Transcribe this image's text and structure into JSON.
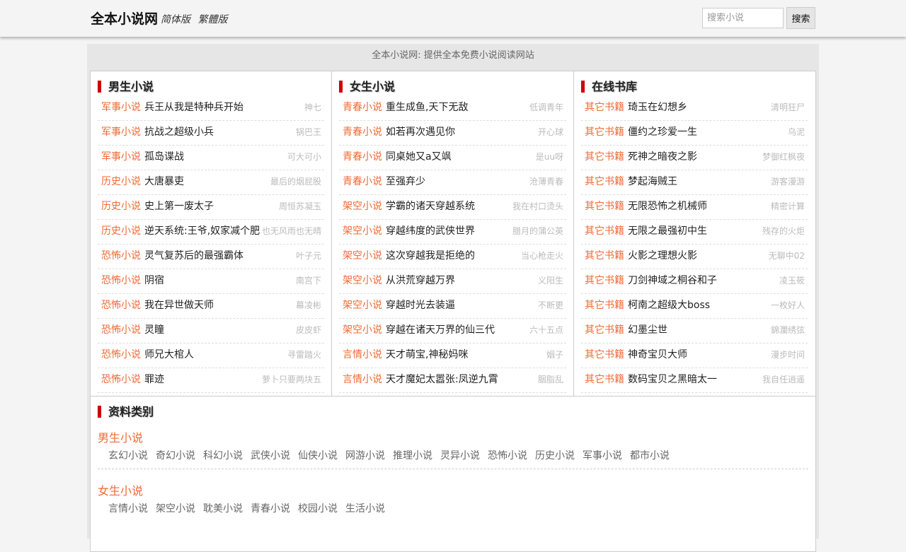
{
  "header": {
    "site_name": "全本小说网",
    "version_links": [
      "简体版",
      "繁體版"
    ],
    "search": {
      "placeholder": "搜索小说",
      "value": "",
      "button_label": "搜索"
    }
  },
  "slogan": "全本小说网: 提供全本免费小说阅读网站",
  "panels": [
    {
      "title": "男生小说",
      "books": [
        {
          "category": "军事小说",
          "title": "兵王从我是特种兵开始",
          "author": "神七"
        },
        {
          "category": "军事小说",
          "title": "抗战之超级小兵",
          "author": "锅巴王"
        },
        {
          "category": "军事小说",
          "title": "孤岛谍战",
          "author": "可大可小"
        },
        {
          "category": "历史小说",
          "title": "大唐暴吏",
          "author": "最后的烟屁股"
        },
        {
          "category": "历史小说",
          "title": "史上第一废太子",
          "author": "周恒苏凝玉"
        },
        {
          "category": "历史小说",
          "title": "逆天系统:王爷,奴家减个肥",
          "author": "也无风雨也无晴"
        },
        {
          "category": "恐怖小说",
          "title": "灵气复苏后的最强霸体",
          "author": "叶子元"
        },
        {
          "category": "恐怖小说",
          "title": "阴宿",
          "author": "南宫下"
        },
        {
          "category": "恐怖小说",
          "title": "我在异世做天师",
          "author": "幕凌彬"
        },
        {
          "category": "恐怖小说",
          "title": "灵瞳",
          "author": "皮皮虾"
        },
        {
          "category": "恐怖小说",
          "title": "师兄大棺人",
          "author": "寻雷踏火"
        },
        {
          "category": "恐怖小说",
          "title": "罪迹",
          "author": "萝卜只要两块五"
        }
      ]
    },
    {
      "title": "女生小说",
      "books": [
        {
          "category": "青春小说",
          "title": "重生成鱼,天下无敌",
          "author": "低调青年"
        },
        {
          "category": "青春小说",
          "title": "如若再次遇见你",
          "author": "开心球"
        },
        {
          "category": "青春小说",
          "title": "同桌她又a又飒",
          "author": "是uu呀"
        },
        {
          "category": "青春小说",
          "title": "至强弃少",
          "author": "沧薄青春"
        },
        {
          "category": "架空小说",
          "title": "学霸的诸天穿越系统",
          "author": "我在村口烫头"
        },
        {
          "category": "架空小说",
          "title": "穿越纬度的武侠世界",
          "author": "腊月的蒲公英"
        },
        {
          "category": "架空小说",
          "title": "这次穿越我是拒绝的",
          "author": "当心枪走火"
        },
        {
          "category": "架空小说",
          "title": "从洪荒穿越万界",
          "author": "义阳生"
        },
        {
          "category": "架空小说",
          "title": "穿越时光去装逼",
          "author": "不断更"
        },
        {
          "category": "架空小说",
          "title": "穿越在诸天万界的仙三代",
          "author": "六十五点"
        },
        {
          "category": "言情小说",
          "title": "天才萌宝,神秘妈咪",
          "author": "姻子"
        },
        {
          "category": "言情小说",
          "title": "天才魔妃太嚣张:凤逆九霄",
          "author": "胭脂乱"
        }
      ]
    },
    {
      "title": "在线书库",
      "books": [
        {
          "category": "其它书籍",
          "title": "琦玉在幻想乡",
          "author": "清明狂尸"
        },
        {
          "category": "其它书籍",
          "title": "僵约之珍爱一生",
          "author": "乌泥"
        },
        {
          "category": "其它书籍",
          "title": "死神之暗夜之影",
          "author": "梦御红枫夜"
        },
        {
          "category": "其它书籍",
          "title": "梦起海贼王",
          "author": "游客漫游"
        },
        {
          "category": "其它书籍",
          "title": "无限恐怖之机械师",
          "author": "精密计算"
        },
        {
          "category": "其它书籍",
          "title": "无限之最强初中生",
          "author": "残存的火炬"
        },
        {
          "category": "其它书籍",
          "title": "火影之理想火影",
          "author": "无聊中02"
        },
        {
          "category": "其它书籍",
          "title": "刀剑神域之桐谷和子",
          "author": "凌玉筱"
        },
        {
          "category": "其它书籍",
          "title": "柯南之超级大boss",
          "author": "一枚好人"
        },
        {
          "category": "其它书籍",
          "title": "幻墨尘世",
          "author": "錦瀾绣弦"
        },
        {
          "category": "其它书籍",
          "title": "神奇宝贝大师",
          "author": "漫步时间"
        },
        {
          "category": "其它书籍",
          "title": "数码宝贝之黑暗太一",
          "author": "我自任逍遥"
        }
      ]
    }
  ],
  "categories": {
    "title": "资料类别",
    "groups": [
      {
        "name": "男生小说",
        "items": [
          "玄幻小说",
          "奇幻小说",
          "科幻小说",
          "武侠小说",
          "仙侠小说",
          "网游小说",
          "推理小说",
          "灵异小说",
          "恐怖小说",
          "历史小说",
          "军事小说",
          "都市小说"
        ]
      },
      {
        "name": "女生小说",
        "items": [
          "言情小说",
          "架空小说",
          "耽美小说",
          "青春小说",
          "校园小说",
          "生活小说"
        ]
      }
    ]
  },
  "colors": {
    "accent": "#f06a35",
    "title_bar": "#cc0000"
  }
}
